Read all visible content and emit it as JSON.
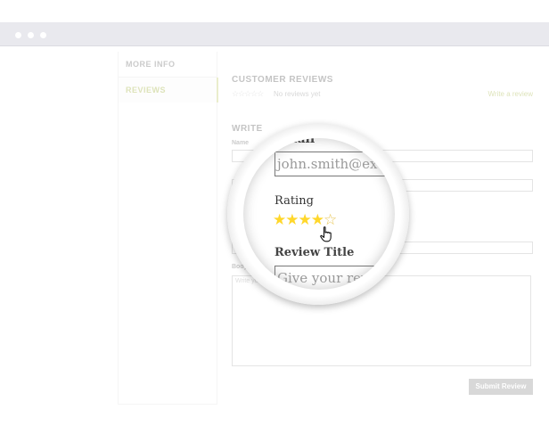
{
  "tabs": {
    "more_info": "MORE INFO",
    "reviews": "REVIEWS"
  },
  "reviews": {
    "title": "CUSTOMER REVIEWS",
    "stars": "☆☆☆☆☆",
    "no_reviews": "No reviews yet",
    "write_link": "Write a review"
  },
  "form": {
    "heading": "WRITE",
    "name_label": "Name",
    "review_label": "R",
    "body_label": "Body of R",
    "body_placeholder": "Write your comm",
    "submit_label": "Submit Review"
  },
  "magnifier": {
    "top_label": "Email",
    "email_value": "john.smith@ex",
    "rating_label": "Rating",
    "rating_value": 4,
    "rating_max": 5,
    "stars_filled": "★★★★",
    "stars_empty": "☆",
    "review_title_label": "Review Title",
    "review_title_placeholder": "Give your rev"
  },
  "colors": {
    "accent": "#a7b64a",
    "star": "#ffd72b",
    "submit_bg": "#9a9a9a",
    "titlebar": "#e9e9ee"
  }
}
